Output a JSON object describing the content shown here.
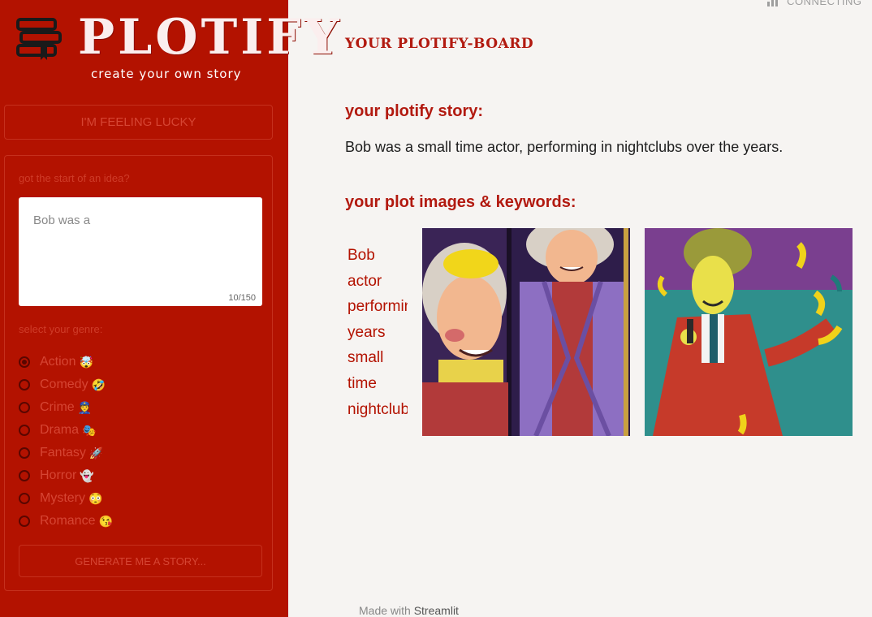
{
  "sidebar": {
    "logo": {
      "title": "PLOTIFY",
      "subtitle": "create your own story"
    },
    "lucky_button": "I'M FEELING LUCKY",
    "idea_label": "got the start of an idea?",
    "idea_value": "Bob was a",
    "char_count": "10/150",
    "genre_label": "select your genre:",
    "genres": [
      {
        "label": "Action",
        "emoji": "🤯",
        "selected": true
      },
      {
        "label": "Comedy",
        "emoji": "🤣",
        "selected": false
      },
      {
        "label": "Crime",
        "emoji": "👮",
        "selected": false
      },
      {
        "label": "Drama",
        "emoji": "🎭",
        "selected": false
      },
      {
        "label": "Fantasy",
        "emoji": "🚀",
        "selected": false
      },
      {
        "label": "Horror",
        "emoji": "👻",
        "selected": false
      },
      {
        "label": "Mystery",
        "emoji": "😳",
        "selected": false
      },
      {
        "label": "Romance",
        "emoji": "😘",
        "selected": false
      }
    ],
    "generate_button": "GENERATE ME A STORY..."
  },
  "main": {
    "status": "CONNECTING",
    "board_title": "YOUR PLOTIFY-BOARD",
    "story_heading": "your plotify story:",
    "story_text": "Bob was a small time actor, performing in nightclubs over the years.",
    "images_heading": "your plot images & keywords:",
    "keywords": [
      "Bob",
      "actor",
      "performing",
      "years",
      "small",
      "time",
      "nightclubs"
    ]
  },
  "footer": {
    "made_with": "Made with",
    "brand": "Streamlit"
  },
  "colors": {
    "sidebar_bg": "#b31200",
    "accent": "#b21a10",
    "page_bg": "#f6f4f2"
  }
}
